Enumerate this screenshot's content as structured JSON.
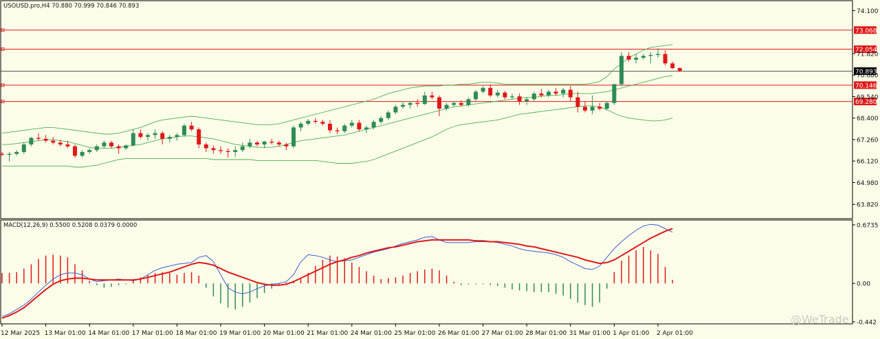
{
  "colors": {
    "background": "#fcfde9",
    "bull": "#2e8b57",
    "bear": "#e01818",
    "band": "#4caf50",
    "level": "#e01818",
    "macd_line": "#3b5bd6",
    "signal_line": "#e01818"
  },
  "watermark": "@WeTrade",
  "chart_data": [
    {
      "type": "candlestick",
      "title": "USOUSD.pro,H4  70.880 70.999 70.846 70.893",
      "ylim": [
        63.5,
        74.3
      ],
      "y_ticks": [
        74.1,
        71.82,
        70.68,
        69.54,
        68.4,
        67.26,
        66.12,
        64.98,
        63.82
      ],
      "y_tick_labels": [
        "74.100",
        "71.820",
        "70.680",
        "69.540",
        "68.400",
        "67.260",
        "66.120",
        "64.980",
        "63.820"
      ],
      "current_price": {
        "value": 70.893,
        "label": "70.893"
      },
      "levels": [
        {
          "value": 73.068,
          "label": "73.068"
        },
        {
          "value": 72.054,
          "label": "72.054"
        },
        {
          "value": 70.146,
          "label": "70.146"
        },
        {
          "value": 69.28,
          "label": "69.280"
        }
      ],
      "x_labels": [
        "12 Mar 2025",
        "13 Mar 01:00",
        "14 Mar 01:00",
        "17 Mar 01:00",
        "18 Mar 01:00",
        "19 Mar 01:00",
        "20 Mar 01:00",
        "21 Mar 01:00",
        "24 Mar 01:00",
        "25 Mar 01:00",
        "26 Mar 01:00",
        "27 Mar 01:00",
        "28 Mar 01:00",
        "31 Mar 01:00",
        "1 Apr 01:00",
        "2 Apr 01:00"
      ],
      "x_label_candle_index": [
        0,
        6,
        12,
        18,
        24,
        30,
        36,
        42,
        48,
        54,
        60,
        66,
        72,
        78,
        84,
        90
      ],
      "candles": [
        [
          66.5,
          66.6,
          66.4,
          66.45
        ],
        [
          66.45,
          66.6,
          66.1,
          66.5
        ],
        [
          66.5,
          66.7,
          66.4,
          66.6
        ],
        [
          66.6,
          67.1,
          66.5,
          67.0
        ],
        [
          67.0,
          67.4,
          66.9,
          67.35
        ],
        [
          67.35,
          67.6,
          67.2,
          67.3
        ],
        [
          67.3,
          67.5,
          67.1,
          67.2
        ],
        [
          67.2,
          67.4,
          67.0,
          67.1
        ],
        [
          67.1,
          67.25,
          66.9,
          67.0
        ],
        [
          67.0,
          67.2,
          66.8,
          66.9
        ],
        [
          66.9,
          67.0,
          66.3,
          66.4
        ],
        [
          66.4,
          66.7,
          66.3,
          66.6
        ],
        [
          66.6,
          66.8,
          66.5,
          66.7
        ],
        [
          66.7,
          67.0,
          66.6,
          66.9
        ],
        [
          66.9,
          67.2,
          66.8,
          67.1
        ],
        [
          67.1,
          67.2,
          66.8,
          66.9
        ],
        [
          66.9,
          67.0,
          66.5,
          66.8
        ],
        [
          66.8,
          67.0,
          66.7,
          66.95
        ],
        [
          66.95,
          67.8,
          66.9,
          67.6
        ],
        [
          67.6,
          67.8,
          67.3,
          67.4
        ],
        [
          67.4,
          67.6,
          67.2,
          67.5
        ],
        [
          67.5,
          67.8,
          67.3,
          67.6
        ],
        [
          67.6,
          67.7,
          67.0,
          67.3
        ],
        [
          67.3,
          67.5,
          67.1,
          67.4
        ],
        [
          67.4,
          67.6,
          67.2,
          67.5
        ],
        [
          67.5,
          68.1,
          67.4,
          68.0
        ],
        [
          68.0,
          68.2,
          67.7,
          67.8
        ],
        [
          67.8,
          67.9,
          66.8,
          67.0
        ],
        [
          67.0,
          67.1,
          66.6,
          66.8
        ],
        [
          66.8,
          66.95,
          66.5,
          66.7
        ],
        [
          66.7,
          66.9,
          66.5,
          66.65
        ],
        [
          66.65,
          66.8,
          66.3,
          66.6
        ],
        [
          66.6,
          66.9,
          66.35,
          66.7
        ],
        [
          66.7,
          67.1,
          66.6,
          66.9
        ],
        [
          66.9,
          67.3,
          66.8,
          67.1
        ],
        [
          67.1,
          67.2,
          66.9,
          67.0
        ],
        [
          67.0,
          67.2,
          66.8,
          67.15
        ],
        [
          67.15,
          67.3,
          67.0,
          67.1
        ],
        [
          67.1,
          67.2,
          66.9,
          67.0
        ],
        [
          67.0,
          67.1,
          66.7,
          66.9
        ],
        [
          66.9,
          68.0,
          66.8,
          67.9
        ],
        [
          67.9,
          68.2,
          67.7,
          68.1
        ],
        [
          68.1,
          68.35,
          68.0,
          68.25
        ],
        [
          68.25,
          68.4,
          68.1,
          68.2
        ],
        [
          68.2,
          68.3,
          68.0,
          68.1
        ],
        [
          68.1,
          68.3,
          67.6,
          67.75
        ],
        [
          67.75,
          67.9,
          67.55,
          67.7
        ],
        [
          67.7,
          68.1,
          67.6,
          68.0
        ],
        [
          68.0,
          68.3,
          67.9,
          68.15
        ],
        [
          68.15,
          68.3,
          67.7,
          67.8
        ],
        [
          67.8,
          68.0,
          67.6,
          67.9
        ],
        [
          67.9,
          68.3,
          67.8,
          68.2
        ],
        [
          68.2,
          68.5,
          68.1,
          68.4
        ],
        [
          68.4,
          68.8,
          68.3,
          68.7
        ],
        [
          68.7,
          69.1,
          68.6,
          69.0
        ],
        [
          69.0,
          69.3,
          68.9,
          69.1
        ],
        [
          69.1,
          69.3,
          68.9,
          69.2
        ],
        [
          69.2,
          69.4,
          69.0,
          69.15
        ],
        [
          69.15,
          69.8,
          69.1,
          69.6
        ],
        [
          69.6,
          69.8,
          69.4,
          69.5
        ],
        [
          69.5,
          69.6,
          68.5,
          68.9
        ],
        [
          68.9,
          69.2,
          68.8,
          69.1
        ],
        [
          69.1,
          69.3,
          69.0,
          69.2
        ],
        [
          69.2,
          69.35,
          69.0,
          69.1
        ],
        [
          69.1,
          69.5,
          69.0,
          69.4
        ],
        [
          69.4,
          69.9,
          69.3,
          69.8
        ],
        [
          69.8,
          70.1,
          69.7,
          70.0
        ],
        [
          70.0,
          70.2,
          69.5,
          69.6
        ],
        [
          69.6,
          69.9,
          69.5,
          69.75
        ],
        [
          69.75,
          69.85,
          69.4,
          69.5
        ],
        [
          69.5,
          69.7,
          69.4,
          69.55
        ],
        [
          69.55,
          69.7,
          69.1,
          69.3
        ],
        [
          69.3,
          69.5,
          69.1,
          69.4
        ],
        [
          69.4,
          69.8,
          69.3,
          69.7
        ],
        [
          69.7,
          69.95,
          69.5,
          69.6
        ],
        [
          69.6,
          69.9,
          69.5,
          69.8
        ],
        [
          69.8,
          70.0,
          69.6,
          69.7
        ],
        [
          69.7,
          70.0,
          69.5,
          69.9
        ],
        [
          69.9,
          70.1,
          69.3,
          69.5
        ],
        [
          69.5,
          69.8,
          68.7,
          69.0
        ],
        [
          69.0,
          69.3,
          68.7,
          68.8
        ],
        [
          68.8,
          69.6,
          68.6,
          69.0
        ],
        [
          69.0,
          69.2,
          68.8,
          68.9
        ],
        [
          68.9,
          69.3,
          68.8,
          69.2
        ],
        [
          69.2,
          70.2,
          69.1,
          70.2
        ],
        [
          70.2,
          71.9,
          70.1,
          71.7
        ],
        [
          71.7,
          71.9,
          71.4,
          71.5
        ],
        [
          71.5,
          71.8,
          71.3,
          71.6
        ],
        [
          71.6,
          71.8,
          71.5,
          71.7
        ],
        [
          71.7,
          71.9,
          71.3,
          71.75
        ],
        [
          71.75,
          72.1,
          71.6,
          71.8
        ],
        [
          71.8,
          72.0,
          71.2,
          71.3
        ],
        [
          71.3,
          71.4,
          71.0,
          71.05
        ],
        [
          71.05,
          71.1,
          70.84,
          70.893
        ]
      ],
      "bb_middle": [
        67.0,
        67.0,
        67.05,
        67.1,
        67.15,
        67.2,
        67.25,
        67.25,
        67.2,
        67.15,
        67.05,
        66.95,
        66.85,
        66.8,
        66.8,
        66.8,
        66.85,
        66.9,
        66.95,
        67.0,
        67.1,
        67.2,
        67.3,
        67.35,
        67.4,
        67.45,
        67.45,
        67.4,
        67.35,
        67.3,
        67.2,
        67.1,
        67.0,
        66.95,
        66.9,
        66.85,
        66.85,
        66.85,
        66.9,
        67.0,
        67.1,
        67.2,
        67.25,
        67.3,
        67.35,
        67.4,
        67.45,
        67.5,
        67.6,
        67.7,
        67.8,
        67.9,
        68.0,
        68.1,
        68.2,
        68.3,
        68.4,
        68.5,
        68.6,
        68.7,
        68.8,
        68.9,
        69.0,
        69.05,
        69.1,
        69.15,
        69.2,
        69.25,
        69.3,
        69.35,
        69.4,
        69.45,
        69.5,
        69.5,
        69.55,
        69.6,
        69.6,
        69.65,
        69.7,
        69.7,
        69.7,
        69.7,
        69.75,
        69.8,
        69.9,
        70.0,
        70.1,
        70.2,
        70.3,
        70.4,
        70.5,
        70.6,
        70.65
      ],
      "bb_upper": [
        67.6,
        67.65,
        67.7,
        67.75,
        67.8,
        67.85,
        67.9,
        67.9,
        67.85,
        67.8,
        67.75,
        67.7,
        67.65,
        67.6,
        67.55,
        67.55,
        67.6,
        67.7,
        67.8,
        67.9,
        68.05,
        68.2,
        68.3,
        68.35,
        68.4,
        68.45,
        68.5,
        68.45,
        68.4,
        68.35,
        68.3,
        68.25,
        68.2,
        68.15,
        68.1,
        68.05,
        68.05,
        68.05,
        68.1,
        68.2,
        68.3,
        68.4,
        68.5,
        68.6,
        68.7,
        68.8,
        68.9,
        69.0,
        69.1,
        69.2,
        69.3,
        69.4,
        69.55,
        69.7,
        69.8,
        69.9,
        70.0,
        70.05,
        70.1,
        70.1,
        70.1,
        70.15,
        70.15,
        70.2,
        70.2,
        70.25,
        70.3,
        70.3,
        70.25,
        70.2,
        70.2,
        70.2,
        70.2,
        70.2,
        70.2,
        70.2,
        70.2,
        70.2,
        70.2,
        70.2,
        70.2,
        70.25,
        70.35,
        70.6,
        71.0,
        71.3,
        71.6,
        71.8,
        72.0,
        72.15,
        72.2,
        72.25,
        72.3
      ],
      "bb_lower": [
        65.85,
        65.85,
        65.85,
        65.85,
        65.85,
        65.85,
        65.85,
        65.85,
        65.85,
        65.85,
        65.8,
        65.8,
        65.85,
        65.9,
        66.0,
        66.1,
        66.2,
        66.25,
        66.25,
        66.25,
        66.25,
        66.25,
        66.25,
        66.25,
        66.25,
        66.25,
        66.25,
        66.25,
        66.25,
        66.2,
        66.2,
        66.2,
        66.2,
        66.2,
        66.2,
        66.15,
        66.15,
        66.15,
        66.15,
        66.15,
        66.15,
        66.15,
        66.15,
        66.15,
        66.1,
        66.05,
        66.0,
        66.0,
        66.0,
        66.05,
        66.1,
        66.2,
        66.35,
        66.5,
        66.65,
        66.8,
        66.95,
        67.1,
        67.25,
        67.4,
        67.6,
        67.8,
        67.95,
        68.05,
        68.1,
        68.15,
        68.2,
        68.25,
        68.3,
        68.4,
        68.5,
        68.6,
        68.65,
        68.7,
        68.75,
        68.8,
        68.85,
        68.9,
        68.95,
        69.0,
        69.05,
        69.05,
        69.0,
        68.85,
        68.65,
        68.5,
        68.4,
        68.35,
        68.3,
        68.25,
        68.25,
        68.3,
        68.4
      ]
    },
    {
      "type": "macd",
      "title": "MACD(12,26,9) 0.5500 0.5208 0.0379 0.0000",
      "ylim": [
        -0.442,
        0.6735
      ],
      "y_tick_labels": [
        "0.6735",
        "0.00",
        "-0.442"
      ],
      "y_ticks": [
        0.6735,
        0.0,
        -0.442
      ],
      "histogram": [
        0.12,
        0.12,
        0.13,
        0.17,
        0.22,
        0.28,
        0.32,
        0.33,
        0.32,
        0.3,
        0.22,
        0.15,
        0.03,
        -0.02,
        -0.05,
        -0.04,
        -0.02,
        -0.01,
        0.03,
        0.07,
        0.1,
        0.12,
        0.13,
        0.12,
        0.1,
        0.12,
        0.13,
        0.09,
        -0.05,
        -0.15,
        -0.23,
        -0.28,
        -0.3,
        -0.27,
        -0.22,
        -0.17,
        -0.11,
        -0.06,
        -0.02,
        0.01,
        0.03,
        0.05,
        0.12,
        0.2,
        0.27,
        0.32,
        0.31,
        0.29,
        0.24,
        0.19,
        0.14,
        0.09,
        0.05,
        0.06,
        0.07,
        0.09,
        0.12,
        0.14,
        0.16,
        0.17,
        0.15,
        0.09,
        0.02,
        -0.02,
        -0.01,
        -0.01,
        -0.01,
        -0.02,
        -0.03,
        -0.05,
        -0.07,
        -0.08,
        -0.09,
        -0.1,
        -0.1,
        -0.1,
        -0.12,
        -0.14,
        -0.18,
        -0.22,
        -0.25,
        -0.27,
        -0.22,
        -0.06,
        0.13,
        0.26,
        0.32,
        0.38,
        0.42,
        0.38,
        0.34,
        0.19,
        0.04
      ],
      "macd": [
        -0.38,
        -0.35,
        -0.3,
        -0.25,
        -0.18,
        -0.1,
        -0.02,
        0.05,
        0.1,
        0.12,
        0.12,
        0.1,
        0.05,
        0.02,
        0.03,
        0.04,
        0.05,
        0.04,
        0.03,
        0.05,
        0.1,
        0.15,
        0.18,
        0.2,
        0.22,
        0.23,
        0.24,
        0.3,
        0.32,
        0.25,
        0.1,
        -0.05,
        -0.1,
        -0.12,
        -0.1,
        -0.06,
        -0.03,
        -0.01,
        0.0,
        0.02,
        0.1,
        0.25,
        0.33,
        0.32,
        0.3,
        0.27,
        0.25,
        0.26,
        0.27,
        0.3,
        0.33,
        0.36,
        0.38,
        0.4,
        0.43,
        0.46,
        0.48,
        0.5,
        0.53,
        0.54,
        0.5,
        0.47,
        0.47,
        0.47,
        0.47,
        0.48,
        0.48,
        0.48,
        0.47,
        0.45,
        0.43,
        0.4,
        0.38,
        0.37,
        0.36,
        0.35,
        0.33,
        0.3,
        0.25,
        0.21,
        0.17,
        0.16,
        0.2,
        0.3,
        0.4,
        0.48,
        0.55,
        0.61,
        0.66,
        0.68,
        0.67,
        0.63,
        0.59
      ],
      "signal": [
        -0.4,
        -0.37,
        -0.33,
        -0.28,
        -0.21,
        -0.14,
        -0.07,
        -0.01,
        0.03,
        0.05,
        0.06,
        0.06,
        0.05,
        0.04,
        0.04,
        0.04,
        0.04,
        0.04,
        0.04,
        0.05,
        0.07,
        0.09,
        0.11,
        0.13,
        0.16,
        0.19,
        0.22,
        0.24,
        0.23,
        0.21,
        0.17,
        0.13,
        0.1,
        0.07,
        0.04,
        0.01,
        -0.01,
        -0.02,
        -0.02,
        -0.01,
        0.02,
        0.06,
        0.1,
        0.14,
        0.18,
        0.22,
        0.25,
        0.27,
        0.3,
        0.32,
        0.35,
        0.37,
        0.39,
        0.41,
        0.42,
        0.44,
        0.46,
        0.48,
        0.49,
        0.5,
        0.5,
        0.5,
        0.5,
        0.5,
        0.5,
        0.49,
        0.49,
        0.48,
        0.48,
        0.47,
        0.46,
        0.45,
        0.43,
        0.42,
        0.4,
        0.38,
        0.36,
        0.34,
        0.32,
        0.3,
        0.27,
        0.25,
        0.23,
        0.24,
        0.27,
        0.32,
        0.37,
        0.42,
        0.47,
        0.52,
        0.56,
        0.6,
        0.63
      ]
    }
  ]
}
